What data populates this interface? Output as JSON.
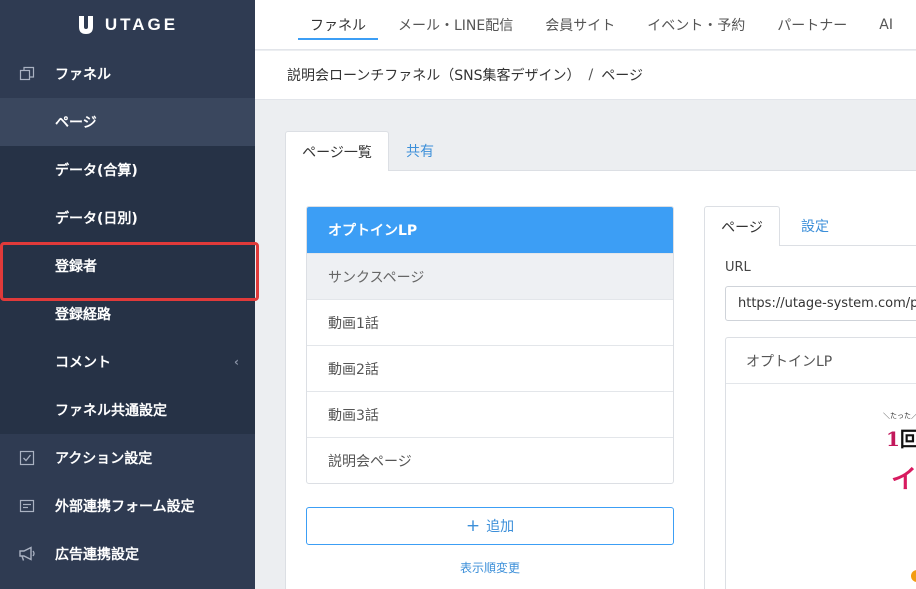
{
  "brand": {
    "name": "UTAGE"
  },
  "sidebar": {
    "items": [
      {
        "label": "ファネル",
        "type": "top",
        "icon": "copy-icon"
      },
      {
        "label": "ページ",
        "type": "sub",
        "active": true
      },
      {
        "label": "データ(合算)",
        "type": "sub"
      },
      {
        "label": "データ(日別)",
        "type": "sub"
      },
      {
        "label": "登録者",
        "type": "sub",
        "highlighted": true
      },
      {
        "label": "登録経路",
        "type": "sub"
      },
      {
        "label": "コメント",
        "type": "sub",
        "chevron": "‹"
      },
      {
        "label": "ファネル共通設定",
        "type": "sub"
      },
      {
        "label": "アクション設定",
        "type": "top",
        "icon": "checkbox-icon"
      },
      {
        "label": "外部連携フォーム設定",
        "type": "top",
        "icon": "form-icon"
      },
      {
        "label": "広告連携設定",
        "type": "top",
        "icon": "megaphone-icon"
      }
    ]
  },
  "header": {
    "tabs": [
      "ファネル",
      "メール・LINE配信",
      "会員サイト",
      "イベント・予約",
      "パートナー",
      "AI"
    ],
    "active_tab": 0
  },
  "breadcrumb": {
    "parent": "説明会ローンチファネル（SNS集客デザイン）",
    "separator": "/",
    "current": "ページ"
  },
  "main": {
    "tabs": [
      "ページ一覧",
      "共有"
    ],
    "pages": [
      "オプトインLP",
      "サンクスページ",
      "動画1話",
      "動画2話",
      "動画3話",
      "説明会ページ"
    ],
    "active_page": 0,
    "hover_page": 1,
    "add_icon": "+",
    "add_label": "追加",
    "reorder_label": "表示順変更"
  },
  "right_panel": {
    "tabs": [
      "ページ",
      "設定"
    ],
    "url_label": "URL",
    "url_value": "https://utage-system.com/p/",
    "preview_title": "オプトインLP",
    "preview_text_small": "＼たった／",
    "preview_text_num": "1",
    "preview_text_char": "回",
    "preview_text_pink": "イ"
  },
  "colors": {
    "sidebar_bg": "#2f3b52",
    "accent": "#3c9ef5",
    "highlight": "#e03a3a"
  }
}
